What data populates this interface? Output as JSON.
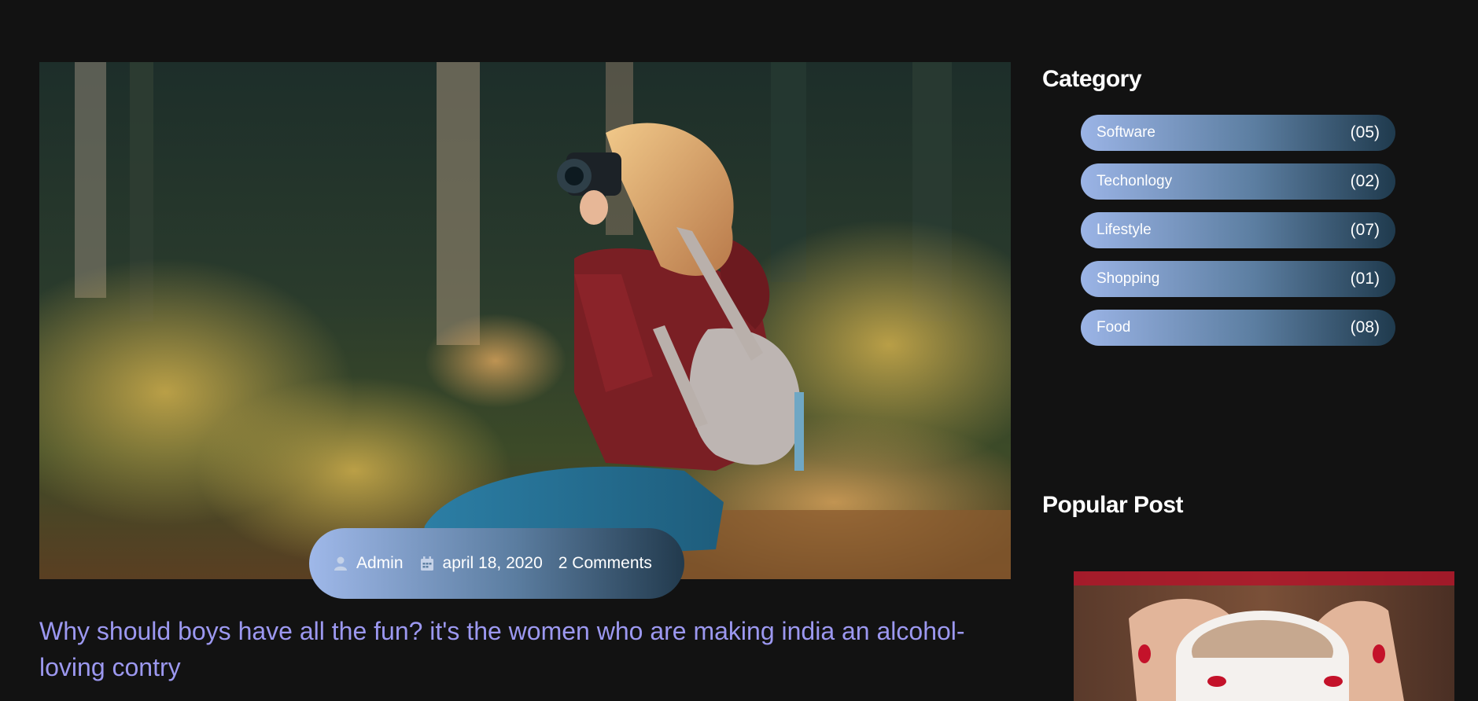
{
  "post": {
    "author": "Admin",
    "date": "april 18, 2020",
    "comments": "2 Comments",
    "title": "Why should boys have all the fun? it's the women who are making india an alcohol-loving contry"
  },
  "sidebar": {
    "category_title": "Category",
    "categories": [
      {
        "name": "Software",
        "count": "(05)"
      },
      {
        "name": "Techonlogy",
        "count": "(02)"
      },
      {
        "name": "Lifestyle",
        "count": "(07)"
      },
      {
        "name": "Shopping",
        "count": "(01)"
      },
      {
        "name": "Food",
        "count": "(08)"
      }
    ],
    "popular_title": "Popular Post"
  },
  "icons": {
    "author": "user-icon",
    "date": "calendar-icon"
  },
  "colors": {
    "background": "#121212",
    "title_accent": "#9c98f0",
    "gradient_start": "#9bb4e6",
    "gradient_end": "#1f3a4d"
  }
}
